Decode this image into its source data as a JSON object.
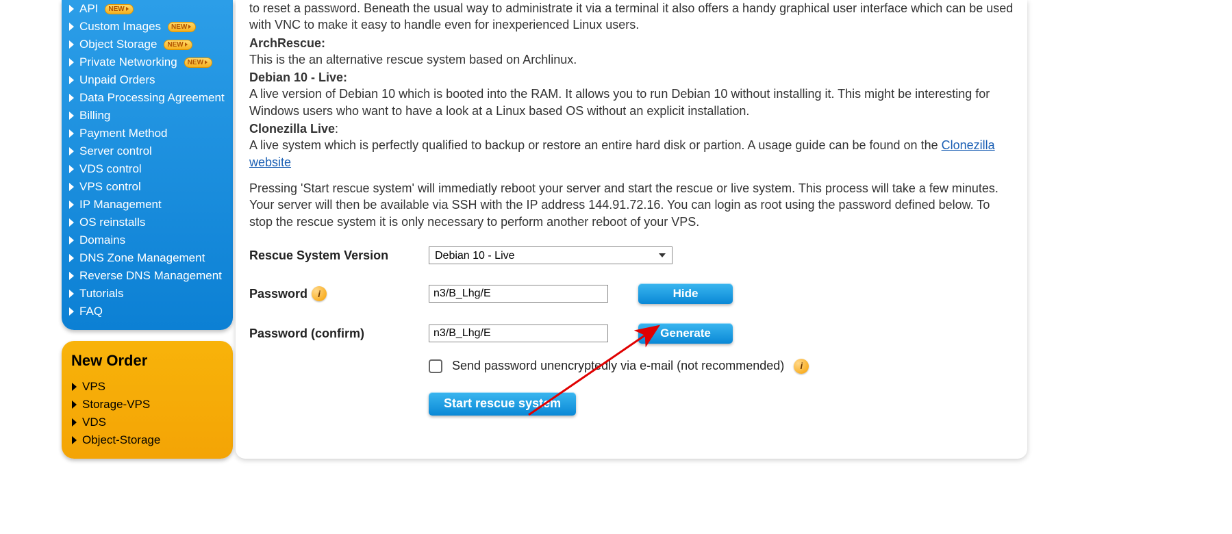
{
  "sidebar": {
    "items": [
      {
        "label": "API",
        "new": true
      },
      {
        "label": "Custom Images",
        "new": true
      },
      {
        "label": "Object Storage",
        "new": true
      },
      {
        "label": "Private Networking",
        "new": true
      },
      {
        "label": "Unpaid Orders",
        "new": false
      },
      {
        "label": "Data Processing Agreement",
        "new": false
      },
      {
        "label": "Billing",
        "new": false
      },
      {
        "label": "Payment Method",
        "new": false
      },
      {
        "label": "Server control",
        "new": false
      },
      {
        "label": "VDS control",
        "new": false
      },
      {
        "label": "VPS control",
        "new": false
      },
      {
        "label": "IP Management",
        "new": false
      },
      {
        "label": "OS reinstalls",
        "new": false
      },
      {
        "label": "Domains",
        "new": false
      },
      {
        "label": "DNS Zone Management",
        "new": false
      },
      {
        "label": "Reverse DNS Management",
        "new": false
      },
      {
        "label": "Tutorials",
        "new": false
      },
      {
        "label": "FAQ",
        "new": false
      }
    ]
  },
  "new_order": {
    "title": "New Order",
    "items": [
      {
        "label": "VPS"
      },
      {
        "label": "Storage-VPS"
      },
      {
        "label": "VDS"
      },
      {
        "label": "Object-Storage"
      }
    ]
  },
  "desc": {
    "intro_cut": "to reset a password. Beneath the usual way to administrate it via a terminal it also offers a handy graphical user interface which can be used with VNC to make it easy to handle even for inexperienced Linux users.",
    "arch_head": "ArchRescue:",
    "arch_body": "This is the an alternative rescue system based on Archlinux.",
    "deb10_head": "Debian 10 - Live:",
    "deb10_body": "A live version of Debian 10 which is booted into the RAM. It allows you to run Debian 10 without installing it. This might be interesting for Windows users who want to have a look at a Linux based OS without an explicit installation.",
    "clonezilla_head": "Clonezilla Live",
    "clonezilla_body_a": "A live system which is perfectly qualified to backup or restore an entire hard disk or partion. A usage guide can be found on the ",
    "clonezilla_link": "Clonezilla website",
    "ssh_press": "Pressing 'Start rescue system' will immediatly reboot your server and start the rescue or live system. This process will take a few minutes. Your server will then be available via SSH with the IP address 144.91.72.16. You can login as root using the password defined below. To stop the rescue system it is only necessary to perform another reboot of your VPS."
  },
  "form": {
    "rescue_label": "Rescue System Version",
    "rescue_selected": "Debian 10 - Live",
    "password_label": "Password",
    "password_value": "n3/B_Lhg/E",
    "hide_btn": "Hide",
    "password_confirm_label": "Password (confirm)",
    "password_confirm_value": "n3/B_Lhg/E",
    "generate_btn": "Generate",
    "send_email_label": "Send password unencryptedly via e-mail (not recommended)",
    "start_btn": "Start rescue system"
  },
  "badge_text": "NEW"
}
